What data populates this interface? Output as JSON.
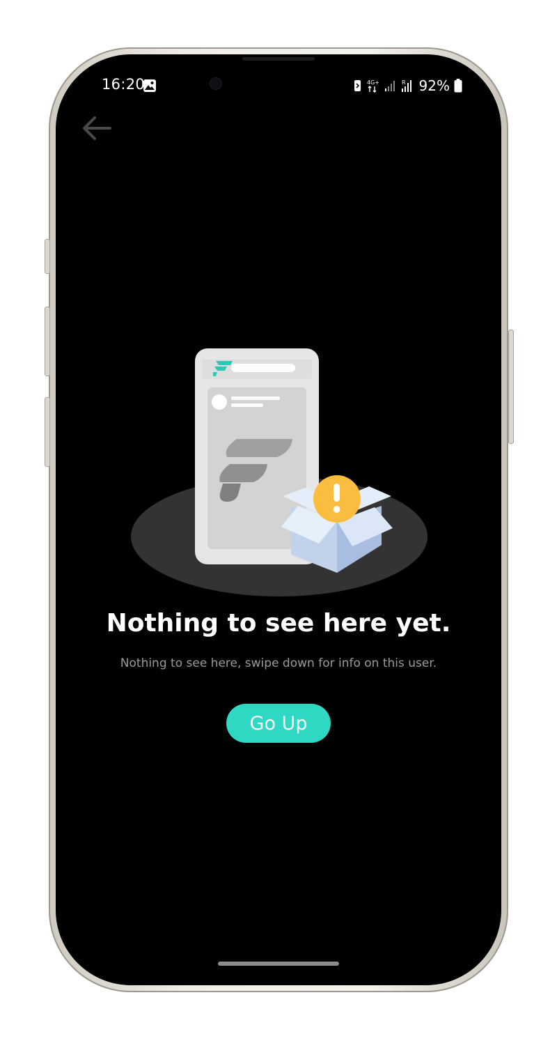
{
  "status_bar": {
    "time": "16:20",
    "network_label": "4G+",
    "battery_percent": "92%",
    "icons": [
      "gallery-icon",
      "nfc-icon",
      "4g-data-icon",
      "signal-icon",
      "signal-roaming-icon",
      "battery-icon"
    ]
  },
  "header": {
    "back_icon": "arrow-left-icon"
  },
  "empty_state": {
    "title": "Nothing to see here yet.",
    "subtitle": "Nothing to see here, swipe down for info on this user.",
    "illustration": "phone-with-open-box-warning",
    "button_label": "Go Up"
  },
  "colors": {
    "accent": "#2ed8c3",
    "background": "#000000",
    "title": "#ffffff",
    "subtitle": "#9a9a9a",
    "warning": "#fbbd3f",
    "box": "#c9d8ef"
  }
}
